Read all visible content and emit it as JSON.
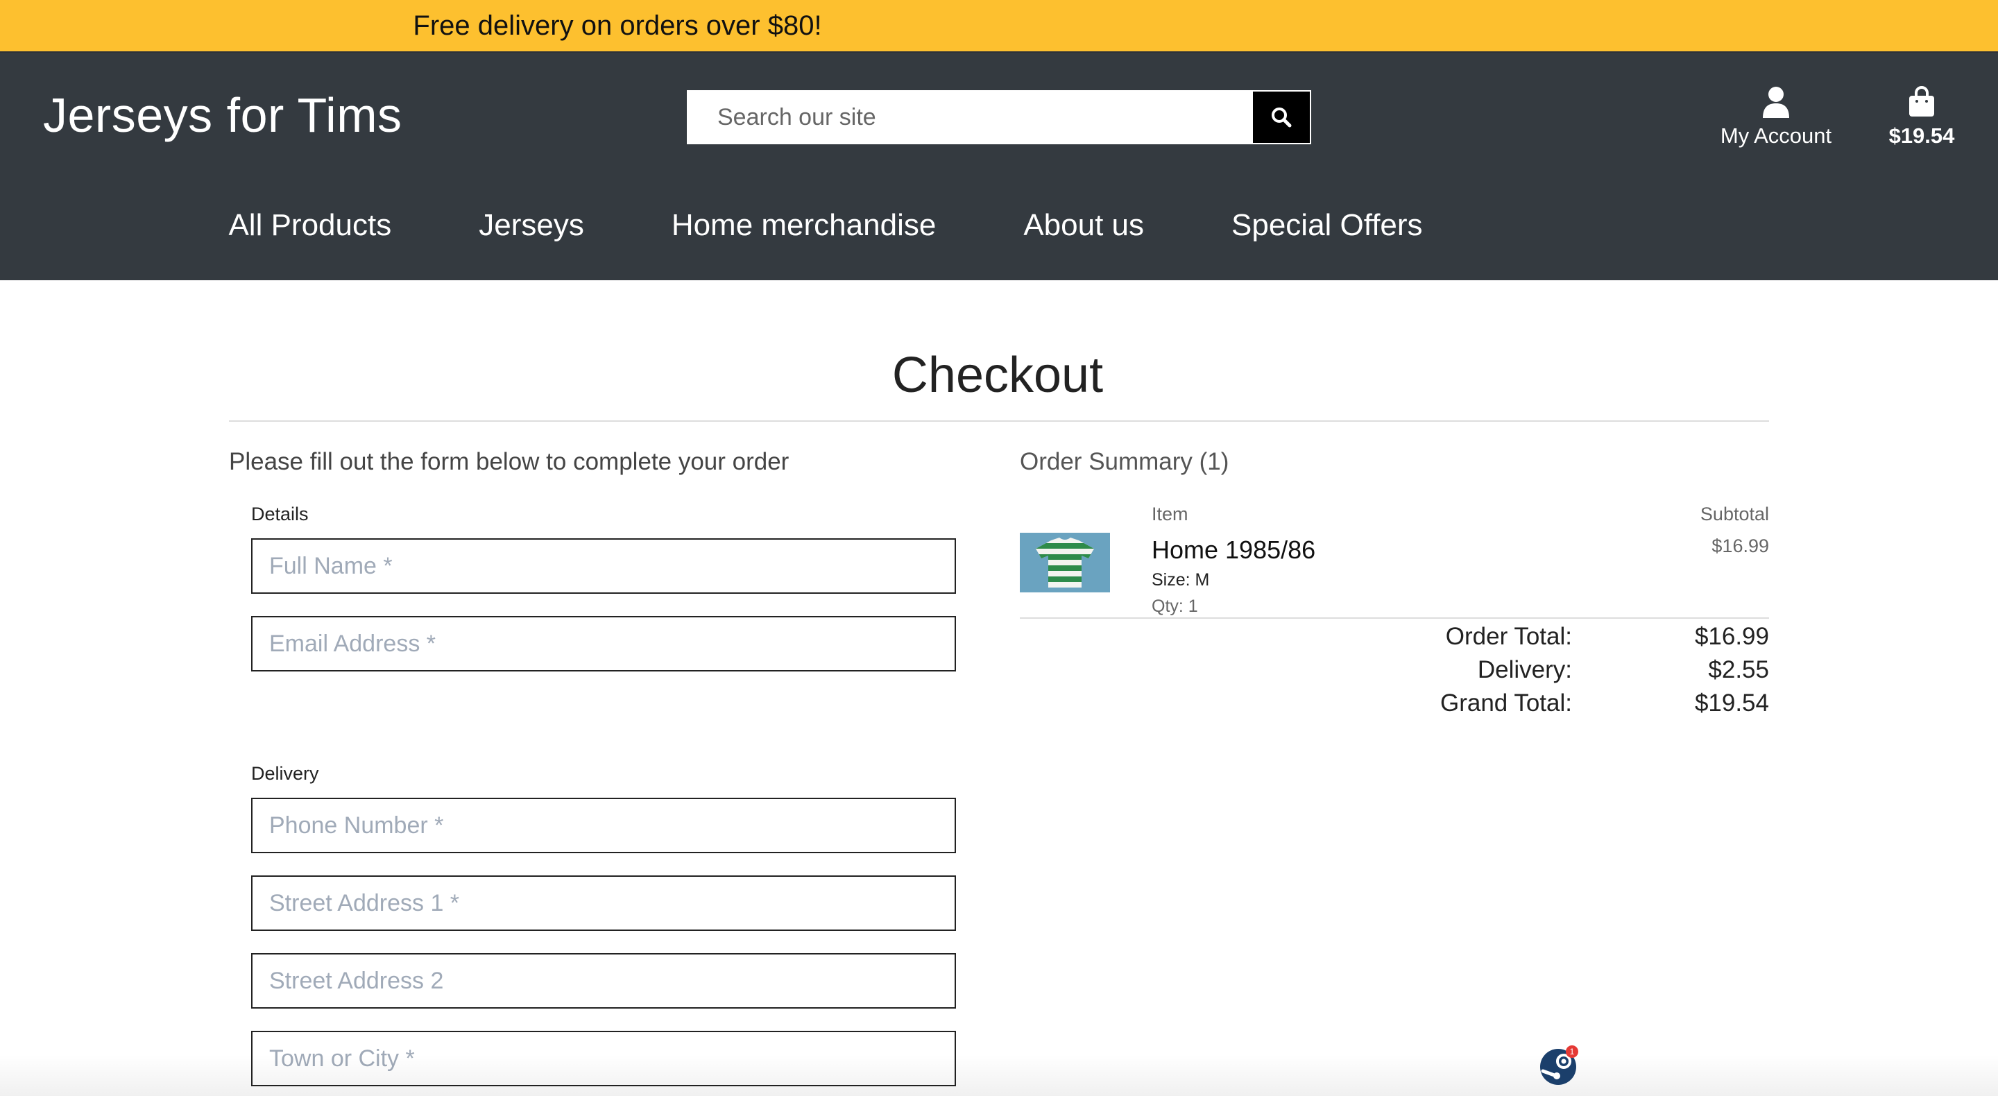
{
  "banner": {
    "text": "Free delivery on orders over $80!"
  },
  "header": {
    "logo": "Jerseys for Tims",
    "search_placeholder": "Search our site",
    "account_label": "My Account",
    "cart_total": "$19.54"
  },
  "nav": {
    "items": [
      "All Products",
      "Jerseys",
      "Home merchandise",
      "About us",
      "Special Offers"
    ]
  },
  "page": {
    "title": "Checkout",
    "intro": "Please fill out the form below to complete your order"
  },
  "form": {
    "details_label": "Details",
    "delivery_label": "Delivery",
    "fields": {
      "full_name": "Full Name *",
      "email": "Email Address *",
      "phone": "Phone Number *",
      "street1": "Street Address 1 *",
      "street2": "Street Address 2",
      "town": "Town or City *"
    }
  },
  "summary": {
    "title": "Order Summary (1)",
    "item_col": "Item",
    "subtotal_col": "Subtotal",
    "item": {
      "name": "Home 1985/86",
      "size": "Size: M",
      "qty": "Qty: 1",
      "subtotal": "$16.99"
    },
    "order_total_label": "Order Total:",
    "order_total": "$16.99",
    "delivery_label": "Delivery:",
    "delivery": "$2.55",
    "grand_total_label": "Grand Total:",
    "grand_total": "$19.54"
  },
  "colors": {
    "banner": "#fdc02f",
    "header": "#343a40",
    "search_button": "#000000"
  },
  "icons": {
    "search": "search-icon",
    "account": "user-icon",
    "cart": "shopping-bag-icon",
    "floating": "steam-icon"
  },
  "floating_badge": "1"
}
